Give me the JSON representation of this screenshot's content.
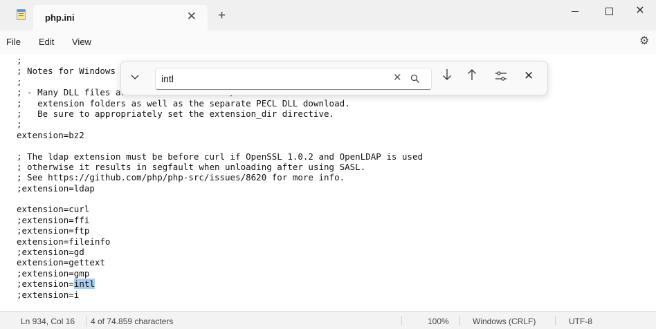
{
  "window": {
    "tab_title": "php.ini"
  },
  "menu": {
    "file": "File",
    "edit": "Edit",
    "view": "View"
  },
  "editor": {
    "lines": [
      ";",
      "; Notes for Windows environments :",
      ";",
      "; - Many DLL files are located in the ext/",
      ";   extension folders as well as the separate PECL DLL download.",
      ";   Be sure to appropriately set the extension_dir directive.",
      ";",
      "extension=bz2",
      "",
      "; The ldap extension must be before curl if OpenSSL 1.0.2 and OpenLDAP is used",
      "; otherwise it results in segfault when unloading after using SASL.",
      "; See https://github.com/php/php-src/issues/8620 for more info.",
      ";extension=ldap",
      "",
      "extension=curl",
      ";extension=ffi",
      ";extension=ftp",
      "extension=fileinfo",
      ";extension=gd",
      "extension=gettext",
      ";extension=gmp"
    ],
    "highlight_line_prefix": ";extension=",
    "highlight_match": "intl",
    "partial_next_line": ";extension=i"
  },
  "find": {
    "query": "intl"
  },
  "status": {
    "position": "Ln 934, Col 16",
    "match_count": "4 of 74.859 characters",
    "zoom": "100%",
    "line_ending": "Windows (CRLF)",
    "encoding": "UTF-8"
  },
  "icons": {
    "app": "notepad-icon",
    "tab_close": "close-icon",
    "new_tab": "plus-icon",
    "minimize": "minimize-icon",
    "maximize": "maximize-icon",
    "close": "close-icon",
    "settings": "gear-icon",
    "find_expand": "chevron-down-icon",
    "find_clear": "clear-icon",
    "find_search": "search-icon",
    "find_next": "arrow-down-icon",
    "find_prev": "arrow-up-icon",
    "find_options": "options-icon",
    "find_close": "close-icon"
  }
}
